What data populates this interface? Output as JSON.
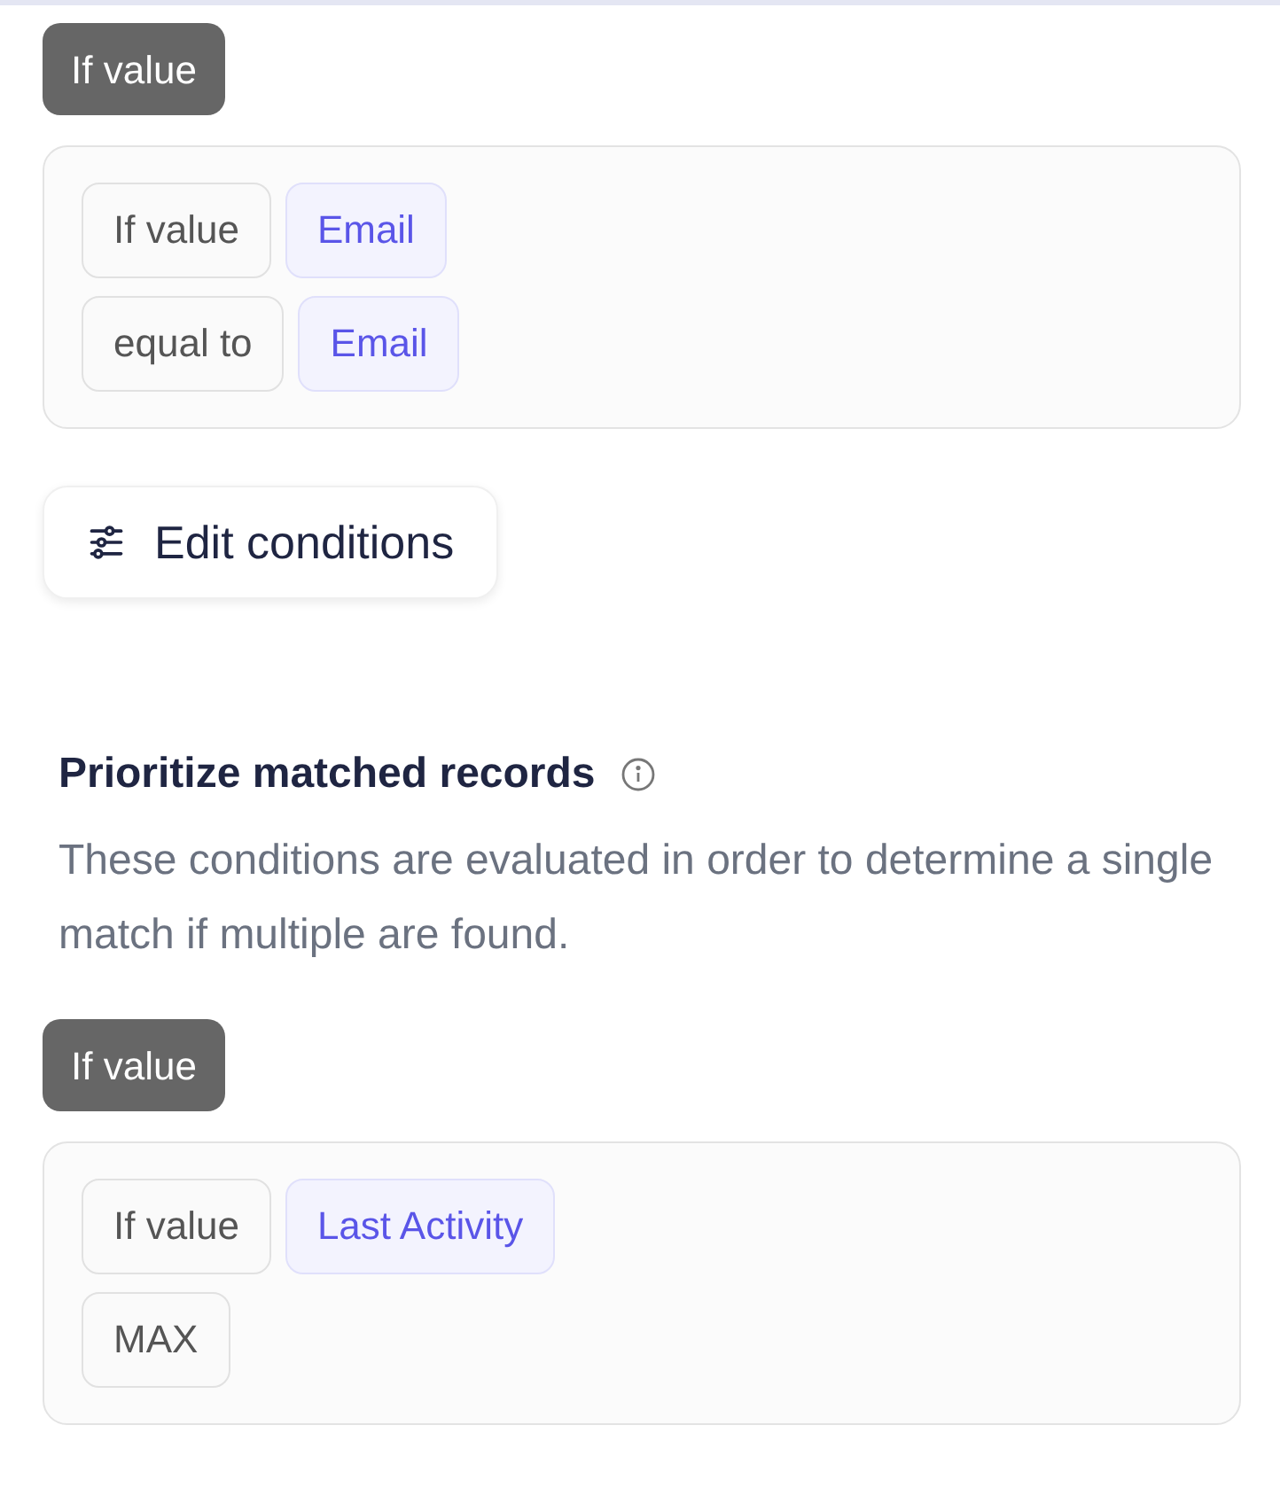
{
  "match_block": {
    "badge": "If value",
    "rows": [
      [
        {
          "kind": "operator",
          "text": "If value"
        },
        {
          "kind": "field",
          "text": "Email"
        }
      ],
      [
        {
          "kind": "operator",
          "text": "equal to"
        },
        {
          "kind": "field",
          "text": "Email"
        }
      ]
    ]
  },
  "edit_button": "Edit conditions",
  "priority_section": {
    "title": "Prioritize matched records",
    "description": "These conditions are evaluated in order to determine a single match if multiple are found.",
    "badge": "If value",
    "rows": [
      [
        {
          "kind": "operator",
          "text": "If value"
        },
        {
          "kind": "field",
          "text": "Last Activity"
        }
      ],
      [
        {
          "kind": "operator",
          "text": "MAX"
        }
      ]
    ]
  }
}
